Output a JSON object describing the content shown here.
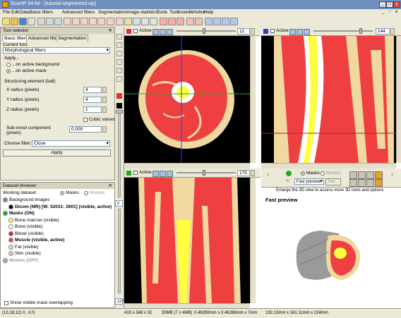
{
  "window": {
    "title": "ScanIP 64-bit - [tutorial-segmented.sip]"
  },
  "menu": [
    "File",
    "Edit",
    "Data",
    "Basic filters",
    "Advanced filters",
    "Segmentation",
    "Image statistics",
    "Tools",
    "Toolboxes",
    "Window",
    "Help"
  ],
  "tool_selector": {
    "title": "Tool selector",
    "tabs": [
      "Basic filters",
      "Advanced filters",
      "Segmentation"
    ],
    "current_tool_label": "Current tool:",
    "current_tool": "Morphological filters",
    "apply_label": "Apply...",
    "apply_options": [
      "...on active background",
      "...on active mask"
    ],
    "structuring_label": "Structuring element (ball)",
    "x_radius_label": "X radius (pixels)",
    "x_radius": "4",
    "y_radius_label": "Y radius (pixels)",
    "y_radius": "4",
    "z_radius_label": "Z radius (pixels)",
    "z_radius": "1",
    "cubic_label": "Cubic values",
    "subvoxel_label": "Sub-voxel component (pixels)",
    "subvoxel": "0.000",
    "filter_label": "Choose filter:",
    "filter": "Close",
    "apply_button": "Apply"
  },
  "dataset_browser": {
    "title": "Dataset browser",
    "working_label": "Working dataset:",
    "mode_masks": "Masks",
    "mode_models": "Models",
    "items": [
      {
        "label": "Background images",
        "color": "#888888",
        "indent": 0
      },
      {
        "label": "Dicom (MR) [W: 52031: 2601] (visible, active)",
        "color": "#000000",
        "indent": 1
      },
      {
        "label": "Masks (ON)",
        "color": "#22aa22",
        "indent": 0
      },
      {
        "label": "Bone marrow (visible)",
        "color": "#ffff44",
        "indent": 1
      },
      {
        "label": "Bone (visible)",
        "color": "#ffffff",
        "indent": 1
      },
      {
        "label": "Blood (visible)",
        "color": "#dd2222",
        "indent": 1
      },
      {
        "label": "Muscle (visible, active)",
        "color": "#ee4444",
        "indent": 1
      },
      {
        "label": "Fat (visible)",
        "color": "#f0d8a0",
        "indent": 1
      },
      {
        "label": "Skin (visible)",
        "color": "#cccccc",
        "indent": 1
      },
      {
        "label": "Models (OFF)",
        "color": "#aaaaaa",
        "indent": 0
      }
    ],
    "show_overlap": "Show visible mask overlapping"
  },
  "views": {
    "active_label": "Active",
    "top_left_slice": "12",
    "top_right_slice": "144",
    "bottom_left_slice": "175",
    "mid_value_top": "0",
    "mid_value_bottom": "127"
  },
  "preview": {
    "mode_masks": "Masks",
    "mode_models": "Models",
    "preview_select": "Fast preview",
    "set_label": "Set...",
    "enlarge_text": "Enlarge the 3D view to access more 3D tools and options",
    "title": "Fast preview"
  },
  "status": {
    "coords": "(13,18,12) 0, -0.5",
    "dims": "415 x 348 x 32",
    "size": "30MB (7 x 4MB)",
    "spacing": "0.46286mm x 0.46286mm x 7mm",
    "extent": "192.13mm x 161.11mm x 224mm"
  },
  "colors": {
    "muscle": "#ee4040",
    "fat": "#f0d8a0",
    "marrow": "#ffff40",
    "bone": "#ffffff",
    "background": "#000000"
  }
}
